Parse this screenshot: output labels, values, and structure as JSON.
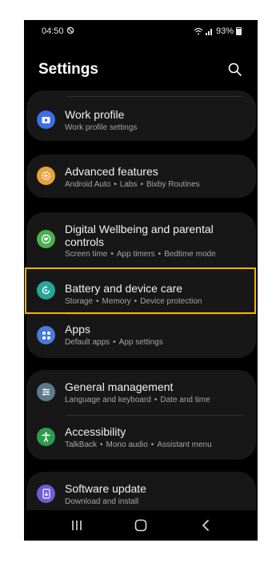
{
  "status_bar": {
    "time": "04:50",
    "battery": "93%"
  },
  "header": {
    "title": "Settings"
  },
  "items": [
    {
      "title": "Work profile",
      "subtitle": [
        "Work profile settings"
      ],
      "icon": "work-profile-icon",
      "color": "#3d6ee8"
    },
    {
      "title": "Advanced features",
      "subtitle": [
        "Android Auto",
        "Labs",
        "Bixby Routines"
      ],
      "icon": "gear-plus-icon",
      "color": "#e8a23a"
    },
    {
      "title": "Digital Wellbeing and parental",
      "title2": "controls",
      "subtitle": [
        "Screen time",
        "App timers",
        "Bedtime mode"
      ],
      "icon": "heart-circle-icon",
      "color": "#4caf50"
    },
    {
      "title": "Battery and device care",
      "subtitle": [
        "Storage",
        "Memory",
        "Device protection"
      ],
      "icon": "refresh-circle-icon",
      "color": "#26a69a"
    },
    {
      "title": "Apps",
      "subtitle": [
        "Default apps",
        "App settings"
      ],
      "icon": "apps-grid-icon",
      "color": "#4a7bdc"
    },
    {
      "title": "General management",
      "subtitle": [
        "Language and keyboard",
        "Date and time"
      ],
      "icon": "sliders-icon",
      "color": "#5b7a8c"
    },
    {
      "title": "Accessibility",
      "subtitle": [
        "TalkBack",
        "Mono audio",
        "Assistant menu"
      ],
      "icon": "accessibility-icon",
      "color": "#2e9c4f"
    },
    {
      "title": "Software update",
      "subtitle": [
        "Download and install"
      ],
      "icon": "software-update-icon",
      "color": "#6b5ed6"
    }
  ],
  "highlight_color": "#f5b400",
  "nav_icons": [
    "recents-icon",
    "home-icon",
    "back-icon"
  ]
}
